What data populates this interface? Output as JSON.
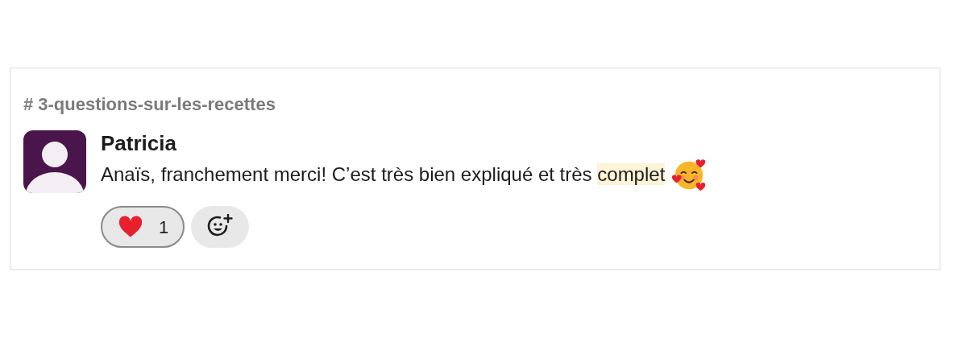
{
  "channel": {
    "prefix": "#",
    "name": "3-questions-sur-les-recettes"
  },
  "message": {
    "author": "Patricia",
    "segments": [
      {
        "text": "Anaïs, franchement merci! C’est très bien expliqué et très ",
        "highlighted": false
      },
      {
        "text": "complet",
        "highlighted": true
      }
    ]
  },
  "reactions": [
    {
      "count": "1",
      "selected": true
    }
  ]
}
